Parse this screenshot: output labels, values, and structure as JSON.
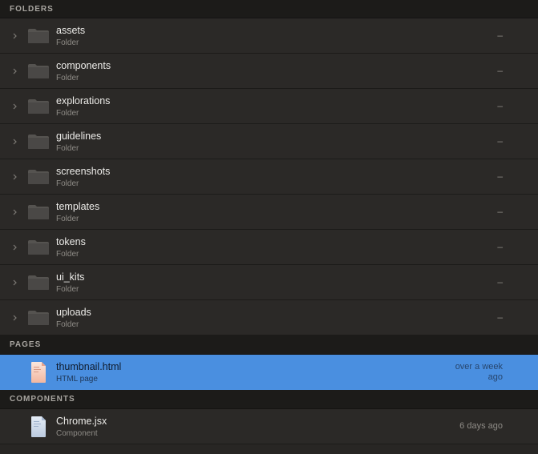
{
  "sections": {
    "folders": "FOLDERS",
    "pages": "PAGES",
    "components": "COMPONENTS"
  },
  "folders": [
    {
      "name": "assets",
      "type": "Folder",
      "meta": "–"
    },
    {
      "name": "components",
      "type": "Folder",
      "meta": "–"
    },
    {
      "name": "explorations",
      "type": "Folder",
      "meta": "–"
    },
    {
      "name": "guidelines",
      "type": "Folder",
      "meta": "–"
    },
    {
      "name": "screenshots",
      "type": "Folder",
      "meta": "–"
    },
    {
      "name": "templates",
      "type": "Folder",
      "meta": "–"
    },
    {
      "name": "tokens",
      "type": "Folder",
      "meta": "–"
    },
    {
      "name": "ui_kits",
      "type": "Folder",
      "meta": "–"
    },
    {
      "name": "uploads",
      "type": "Folder",
      "meta": "–"
    }
  ],
  "pages": [
    {
      "name": "thumbnail.html",
      "type": "HTML page",
      "meta": "over a week ago",
      "selected": true
    }
  ],
  "components": [
    {
      "name": "Chrome.jsx",
      "type": "Component",
      "meta": "6 days ago"
    }
  ],
  "icons": {
    "chevron": "chevron-right-icon",
    "folder": "folder-icon",
    "html_file": "html-file-icon",
    "jsx_file": "jsx-file-icon"
  },
  "colors": {
    "selection": "#4a8fe0",
    "background": "#282624",
    "header": "#1c1b19"
  }
}
